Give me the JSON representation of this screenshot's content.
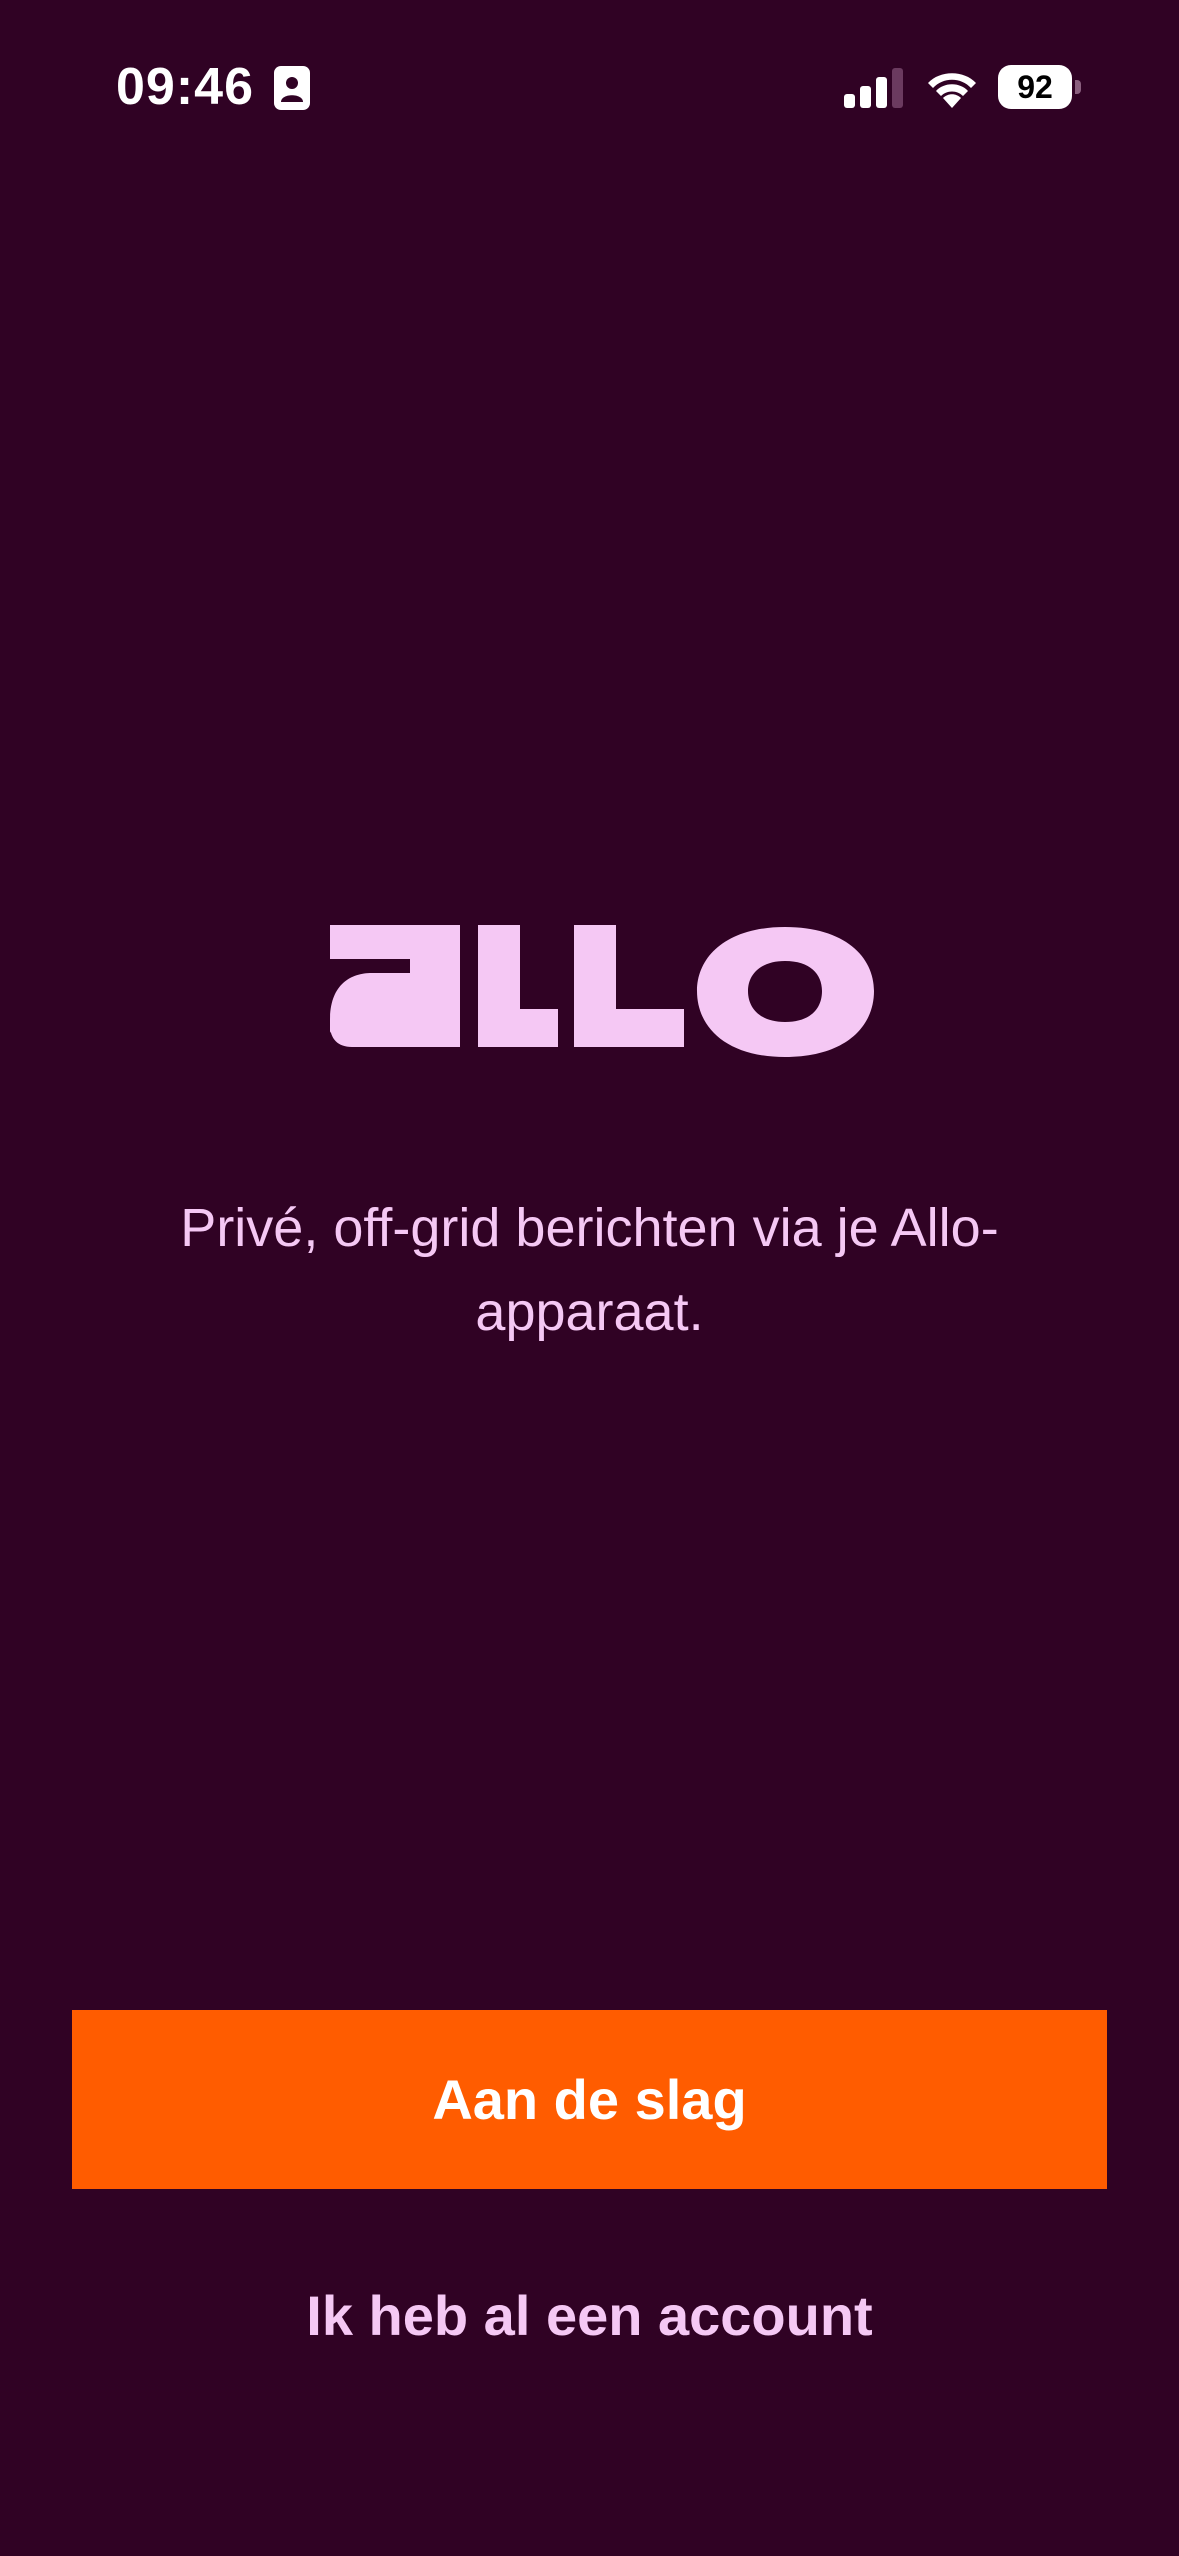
{
  "status_bar": {
    "time": "09:46",
    "battery_level": "92",
    "icons": [
      "contact-card-icon",
      "cellular-signal-icon",
      "wifi-icon",
      "battery-icon"
    ]
  },
  "logo": {
    "text": "allo"
  },
  "tagline": "Privé, off-grid berichten via je Allo-apparaat.",
  "actions": {
    "primary_label": "Aan de slag",
    "secondary_label": "Ik heb al een account"
  },
  "colors": {
    "background": "#300224",
    "logo": "#F5C8F4",
    "text_primary": "#F5C8F4",
    "button_primary": "#FF5C00",
    "button_text": "#FFFFFF"
  }
}
